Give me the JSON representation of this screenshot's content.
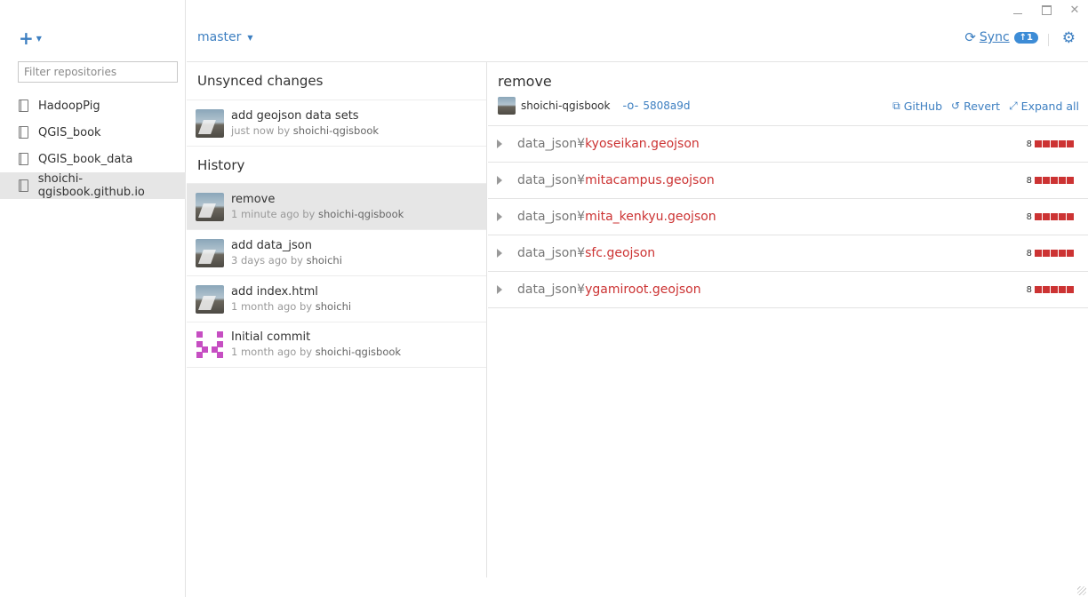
{
  "window": {
    "minimize": "–",
    "maximize": "",
    "close": "✕"
  },
  "sidebar": {
    "add_icon": "plus-icon",
    "filter_placeholder": "Filter repositories",
    "repos": [
      {
        "name": "HadoopPig",
        "active": false
      },
      {
        "name": "QGIS_book",
        "active": false
      },
      {
        "name": "QGIS_book_data",
        "active": false
      },
      {
        "name": "shoichi-qgisbook.github.io",
        "active": true
      }
    ]
  },
  "topbar": {
    "branch": "master",
    "sync_label": "Sync",
    "sync_badge": "↑1",
    "settings_icon": "gear-icon"
  },
  "middle": {
    "unsynced_title": "Unsynced changes",
    "unsynced": [
      {
        "message": "add geojson data sets",
        "time": "just now",
        "by": "by",
        "author": "shoichi-qgisbook"
      }
    ],
    "history_title": "History",
    "history": [
      {
        "message": "remove",
        "time": "1 minute ago",
        "by": "by",
        "author": "shoichi-qgisbook",
        "active": true
      },
      {
        "message": "add data_json",
        "time": "3 days ago",
        "by": "by",
        "author": "shoichi",
        "active": false
      },
      {
        "message": "add index.html",
        "time": "1 month ago",
        "by": "by",
        "author": "shoichi",
        "active": false
      },
      {
        "message": "Initial commit",
        "time": "1 month ago",
        "by": "by",
        "author": "shoichi-qgisbook",
        "active": false
      }
    ]
  },
  "detail": {
    "title": "remove",
    "author": "shoichi-qgisbook",
    "sha": "5808a9d",
    "actions": {
      "github": "GitHub",
      "revert": "Revert",
      "expand": "Expand all"
    },
    "files": [
      {
        "dir": "data_json¥",
        "name": "kyoseikan.geojson",
        "count": "8"
      },
      {
        "dir": "data_json¥",
        "name": "mitacampus.geojson",
        "count": "8"
      },
      {
        "dir": "data_json¥",
        "name": "mita_kenkyu.geojson",
        "count": "8"
      },
      {
        "dir": "data_json¥",
        "name": "sfc.geojson",
        "count": "8"
      },
      {
        "dir": "data_json¥",
        "name": "ygamiroot.geojson",
        "count": "8"
      }
    ]
  },
  "colors": {
    "accent": "#3d7fc1",
    "deletion": "#cc3333",
    "active_row": "#e6e6e6"
  }
}
